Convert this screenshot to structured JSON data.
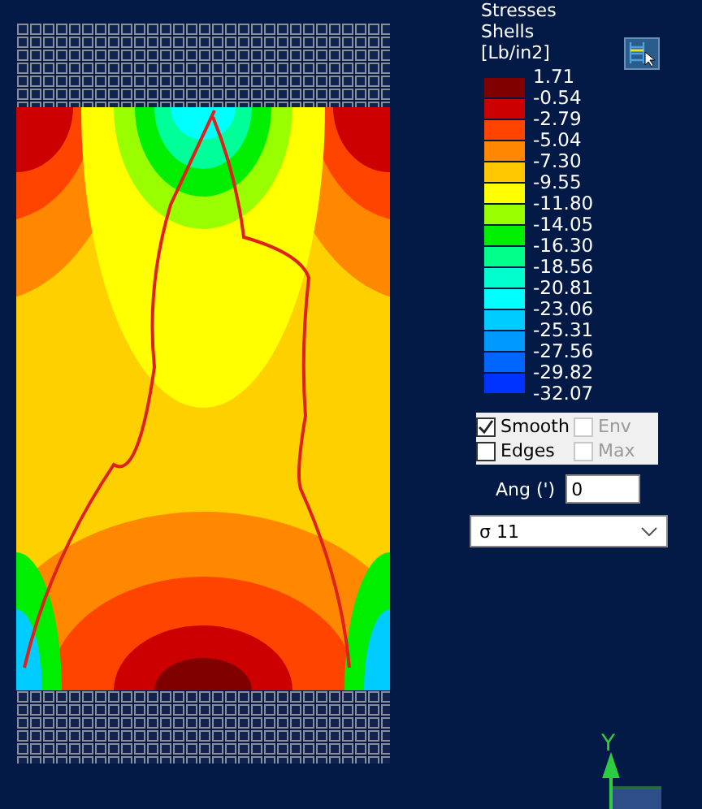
{
  "legend": {
    "title_lines": [
      "Stresses",
      "Shells",
      "[Lb/in2]"
    ],
    "levels": [
      "1.71",
      "-0.54",
      "-2.79",
      "-5.04",
      "-7.30",
      "-9.55",
      "-11.80",
      "-14.05",
      "-16.30",
      "-18.56",
      "-20.81",
      "-23.06",
      "-25.31",
      "-27.56",
      "-29.82",
      "-32.07"
    ],
    "bands": [
      {
        "color": "#800000"
      },
      {
        "color": "#cc0000"
      },
      {
        "color": "#ff4400"
      },
      {
        "color": "#ff8800"
      },
      {
        "color": "#ffc800"
      },
      {
        "color": "#ffff00"
      },
      {
        "color": "#99ff00"
      },
      {
        "color": "#00ee00"
      },
      {
        "color": "#00ff88"
      },
      {
        "color": "#00ffcc"
      },
      {
        "color": "#00ffff"
      },
      {
        "color": "#00ccff"
      },
      {
        "color": "#0099ff"
      },
      {
        "color": "#0066ff"
      },
      {
        "color": "#0033ff"
      }
    ]
  },
  "options": [
    {
      "label": "Smooth",
      "checked": true,
      "disabled": false
    },
    {
      "label": "Env",
      "checked": false,
      "disabled": true
    },
    {
      "label": "Edges",
      "checked": false,
      "disabled": false
    },
    {
      "label": "Max",
      "checked": false,
      "disabled": true
    }
  ],
  "angle": {
    "label": "Ang (')",
    "value": "0"
  },
  "component": {
    "value": "σ 11"
  },
  "axis": {
    "label": "Y"
  }
}
